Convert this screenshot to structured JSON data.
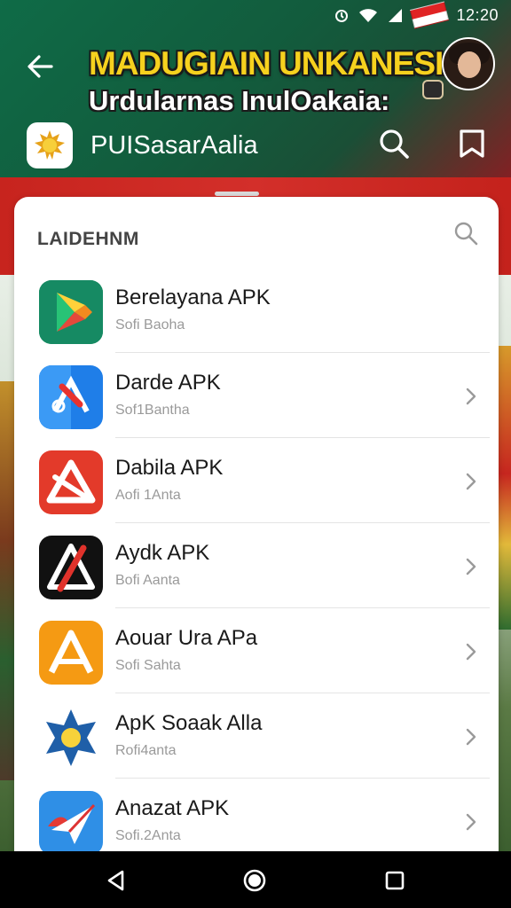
{
  "status_bar": {
    "time": "12:20"
  },
  "header": {
    "headline_line1": "MADUGIAIN UNKANESIA",
    "headline_line2": "Urdularnas InulOakaia:",
    "search_text": "PUISasarAalia"
  },
  "section": {
    "title": "LAIDEHNM"
  },
  "apps": [
    {
      "name": "Berelayana APK",
      "subtitle": "Sofi Baoha",
      "icon": "play-store-icon",
      "chevron": false
    },
    {
      "name": "Darde APK",
      "subtitle": "Sof1Bantha",
      "icon": "satellite-app-icon",
      "chevron": true
    },
    {
      "name": "Dabila APK",
      "subtitle": "Aofi 1Anta",
      "icon": "red-triangle-app-icon",
      "chevron": true
    },
    {
      "name": "Aydk APK",
      "subtitle": "Bofi Aanta",
      "icon": "black-slash-app-icon",
      "chevron": true
    },
    {
      "name": "Aouar Ura APa",
      "subtitle": "Sofi Sahta",
      "icon": "orange-a-app-icon",
      "chevron": true
    },
    {
      "name": "ApK Soaak Alla",
      "subtitle": "Rofi4anta",
      "icon": "blue-sun-app-icon",
      "chevron": true
    },
    {
      "name": "Anazat APK",
      "subtitle": "Sofi.2Anta",
      "icon": "paper-plane-app-icon",
      "chevron": true
    }
  ],
  "colors": {
    "header_green": "#0f6b47",
    "headline_yellow": "#f6d11e",
    "banner_red": "#d32f2a"
  }
}
